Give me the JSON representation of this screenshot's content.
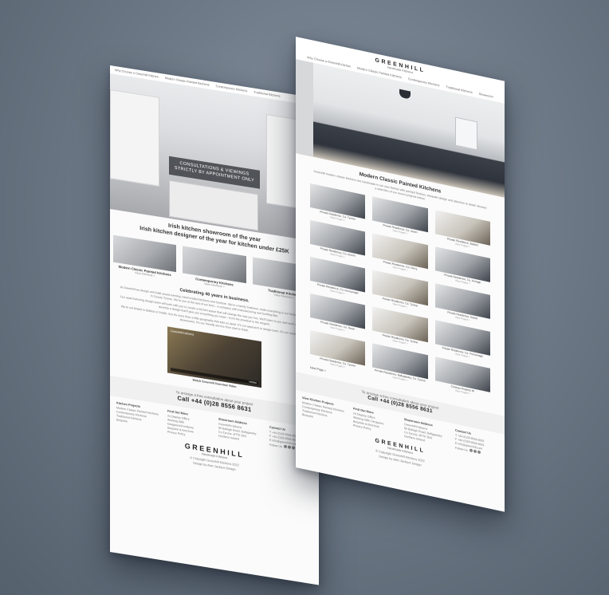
{
  "left_page": {
    "nav": [
      "Why Choose a Greenhill Kitchen",
      "Modern Classic Painted Kitchens",
      "Contemporary Kitchens",
      "Traditional Kitchens"
    ],
    "hero_overlay": [
      "CONSULTATIONS & VIEWINGS",
      "STRICTLY BY APPOINTMENT ONLY"
    ],
    "headline": [
      "Irish kitchen showroom of the year",
      "Irish kitchen designer of the year for kitchen under £25K"
    ],
    "thumbs": [
      {
        "caption": "Modern Classic Painted Kitchens",
        "link": "View Kitchens >"
      },
      {
        "caption": "Contemporary Kitchens",
        "link": "View Kitchens >"
      },
      {
        "caption": "Traditional Kitchens",
        "link": "View Kitchens >"
      }
    ],
    "celebrating": "Celebrating 40 years in business.",
    "para1": "At Greenhill we design and build award-winning, hand-crafted kitchens and furniture. We're a family business, make everything in our factory, on site, in County Tyrone. We're one of the last of our kind – a company with manufacturing and building flair.",
    "para2": "Our award-winning design team will work with you to create a kitchen space that will change the way you live. We'll listen to you and work with you to develop a design that'll give you everything you need – from the practical to the elegant.",
    "para3": "We're not limited in Belfast or Dublin. But it's more than a little geography that sets us apart. It's our approach to design team. It's our award-winning showrooms. It's our friendly service from start to finish.",
    "video": {
      "brand": "Greenhill Kitchens",
      "vimeo": "vimeo",
      "caption": "Watch Greenhill Overview Video"
    },
    "cta": {
      "line1": "To arrange a free consultation about your project",
      "phone": "Call +44 (0)28 8556 8631"
    },
    "footer": [
      {
        "heading": "Kitchen Projects",
        "items": [
          "Modern Classic Painted Kitchens",
          "Contemporary Kitchens",
          "Traditional Kitchens",
          "Bespoke"
        ]
      },
      {
        "heading": "Find Out More",
        "items": [
          "24 Display Offers",
          "Working With Designers/Architects",
          "Bespoke & Brochure",
          "Privacy Policy"
        ]
      },
      {
        "heading": "Showroom Address",
        "items": [
          "Greenhill Kitchens",
          "95 Ballagh Road, Ballygawley",
          "Co.Tyrone, BT70 2EN",
          "Northern Ireland"
        ]
      },
      {
        "heading": "Contact Us",
        "items": [
          "T +44 (0)28 8556 8631",
          "F +44 (0)28 8556 8631",
          "E info@greenhill.com",
          "Follow Us"
        ]
      }
    ],
    "logo": "GREENHILL",
    "logo_sub": "Handmade Kitchens",
    "copyright": [
      "© Copyright Greenhill Kitchens 2022",
      "Design by Alan Jackson Design"
    ]
  },
  "right_page": {
    "logo": "GREENHILL",
    "logo_sub": "Handmade Kitchens",
    "nav": [
      "Why Choose a Greenhill Kitchen",
      "Modern Classic Painted Kitchens",
      "Contemporary Kitchens",
      "Traditional Kitchens",
      "Showroom"
    ],
    "title": "Modern Classic Painted Kitchens",
    "intro": "Greenhill modern classic kitchens are handmade in our own factory with painted finishes, bespoke design and attention to detail. Browse a selection of our recent projects below.",
    "grid": [
      {
        "caption": "Private Residence, Co. Tyrone",
        "link": "View Project >"
      },
      {
        "caption": "Private Residence, Co. Down",
        "link": "View Project >"
      },
      {
        "caption": "Private Residence, Belfast",
        "link": "View Project >"
      },
      {
        "caption": "Private Residence, Co. Antrim",
        "link": "View Project >"
      },
      {
        "caption": "Private Residence, Co. Derry",
        "link": "View Project >"
      },
      {
        "caption": "Private Residence, Co. Armagh",
        "link": "View Project >"
      },
      {
        "caption": "Private Residence, Co. Fermanagh",
        "link": "View Project >"
      },
      {
        "caption": "Private Residence, Co. Tyrone",
        "link": "View Project >"
      },
      {
        "caption": "Private Residence, Dublin",
        "link": "View Project >"
      },
      {
        "caption": "Private Residence, Co. Down",
        "link": "View Project >"
      },
      {
        "caption": "Private Residence, Co. Tyrone",
        "link": "View Project >"
      },
      {
        "caption": "Private Residence, Co. Fermanagh",
        "link": "View Project >"
      },
      {
        "caption": "Private Residence, Co. Tyrone",
        "link": "View Project >"
      },
      {
        "caption": "Private Residence, Ballygawley, Co. Tyrone",
        "link": "View Project >"
      },
      {
        "caption": "Contract Projects NI",
        "link": "View Project >"
      }
    ],
    "next_page": "Next Page >",
    "cta": {
      "line1": "To arrange a free consultation about your project",
      "phone": "Call +44 (0)28 8556 8631"
    },
    "footer": [
      {
        "heading": "View Kitchen Projects",
        "items": [
          "Modern Classic Painted Kitchens",
          "Contemporary Kitchens",
          "Traditional Kitchens",
          "Bespoke"
        ]
      },
      {
        "heading": "Find Out More",
        "items": [
          "24 Display Offers",
          "Working With Designers",
          "Bespoke & Brochure",
          "Privacy Policy"
        ]
      },
      {
        "heading": "Showroom Address",
        "items": [
          "Greenhill Kitchens",
          "95 Ballagh Road, Ballygawley",
          "Co.Tyrone, BT70 2EN",
          "Northern Ireland"
        ]
      },
      {
        "heading": "Contact Us",
        "items": [
          "T +44 (0)28 8556 8631",
          "F +44 (0)28 8556 8631",
          "E info@greenhill.com",
          "Follow Us"
        ]
      }
    ],
    "copyright": [
      "© Copyright Greenhill Kitchens 2022",
      "Design by Alan Jackson Design"
    ]
  }
}
